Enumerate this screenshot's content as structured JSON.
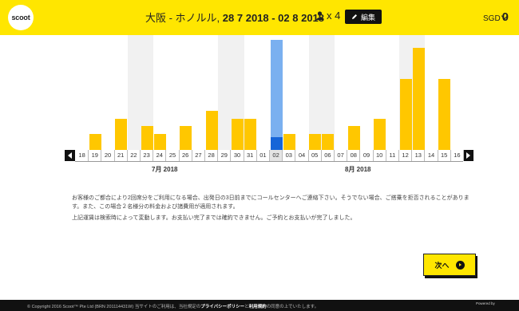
{
  "header": {
    "logo_text": "scoot",
    "route_label": "大阪 - ホノルル,",
    "dates": "28 7 2018 - 02 8 2018",
    "pax_count": "x 4",
    "edit_label": "編集",
    "currency_code": "SGD",
    "currency_amount": "0"
  },
  "chart": {
    "ticks": [
      "18",
      "19",
      "20",
      "21",
      "22",
      "23",
      "24",
      "25",
      "26",
      "27",
      "28",
      "29",
      "30",
      "31",
      "01",
      "02",
      "03",
      "04",
      "05",
      "06",
      "07",
      "08",
      "09",
      "10",
      "11",
      "12",
      "13",
      "14",
      "15",
      "16"
    ],
    "months": [
      {
        "label": "7月 2018"
      },
      {
        "label": "8月 2018"
      }
    ],
    "selected_tick": "02"
  },
  "chart_data": {
    "type": "bar",
    "categories": [
      "18",
      "19",
      "20",
      "21",
      "22",
      "23",
      "24",
      "25",
      "26",
      "27",
      "28",
      "29",
      "30",
      "31",
      "01",
      "02",
      "03",
      "04",
      "05",
      "06",
      "07",
      "08",
      "09",
      "10",
      "11",
      "12",
      "13",
      "14",
      "15",
      "16"
    ],
    "values": [
      0,
      2,
      0,
      4,
      0,
      3,
      2,
      0,
      3,
      0,
      5,
      0,
      4,
      4,
      0,
      14,
      2,
      0,
      2,
      2,
      0,
      3,
      0,
      4,
      0,
      9,
      13,
      0,
      9,
      0
    ],
    "selected_category": "02",
    "ylim": [
      0,
      14
    ],
    "xlabel": "",
    "ylabel": ""
  },
  "notes": {
    "para1": "お客様のご都合により2回席分をご利用になる場合、出発日の3日前までにコールセンターへご連絡下さい。そうでない場合、ご搭乗を拒否されることがあります。また、この場合２名様分の料金および諸費用が適用されます。",
    "para2": "上記運賃は検索時によって変動します。お支払い完了までは確約できません。ご予約とお支払いが完了しました。"
  },
  "next_label": "次へ",
  "footer": {
    "copyright": "© Copyright 2016 Scoot™ Pte Ltd (BRN 201114431W) 当サイトのご利用は、当社規定の",
    "privacy": "プライバシーポリシー",
    "and": "と",
    "terms": "利用規約",
    "tail": "の同意の上でいたします。",
    "powered": "Powered by"
  },
  "colors": {
    "brand_yellow": "#ffe600",
    "bar": "#ffc700",
    "selected": "#7ab0f0",
    "selected_base": "#1565d8"
  }
}
